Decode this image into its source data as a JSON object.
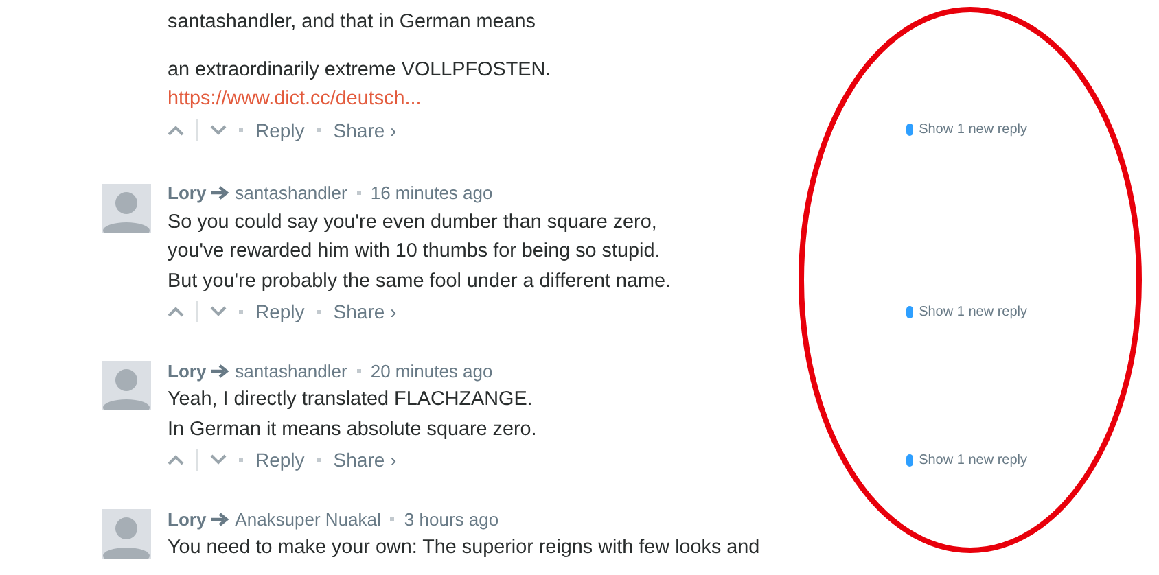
{
  "comments": [
    {
      "paragraphs": [
        "santashandler, and that in German means",
        "an extraordinarily extreme VOLLPFOSTEN."
      ],
      "link": "https://www.dict.cc/deutsch...",
      "actions": [
        "Reply",
        "Share ›"
      ],
      "new_replies": "Show 1 new reply"
    },
    {
      "author": "Lory",
      "reply_to": "santashandler",
      "time": "16 minutes ago",
      "paragraphs": [
        "So you could say you're even dumber than square zero,\nyou've rewarded him with 10 thumbs for being so stupid.\nBut you're probably the same fool under a different name."
      ],
      "actions": [
        "Reply",
        "Share ›"
      ],
      "new_replies": "Show 1 new reply"
    },
    {
      "author": "Lory",
      "reply_to": "santashandler",
      "time": "20 minutes ago",
      "paragraphs": [
        "Yeah, I directly translated FLACHZANGE.\nIn German it means absolute square zero."
      ],
      "actions": [
        "Reply",
        "Share ›"
      ],
      "new_replies": "Show 1 new reply"
    },
    {
      "author": "Lory",
      "reply_to": "Anaksuper Nuakal",
      "time": "3 hours ago",
      "paragraphs": [
        "You need to make your own: The superior reigns with few looks and"
      ]
    }
  ],
  "annotation": {
    "kind": "ellipse",
    "color": "#e8000b"
  }
}
